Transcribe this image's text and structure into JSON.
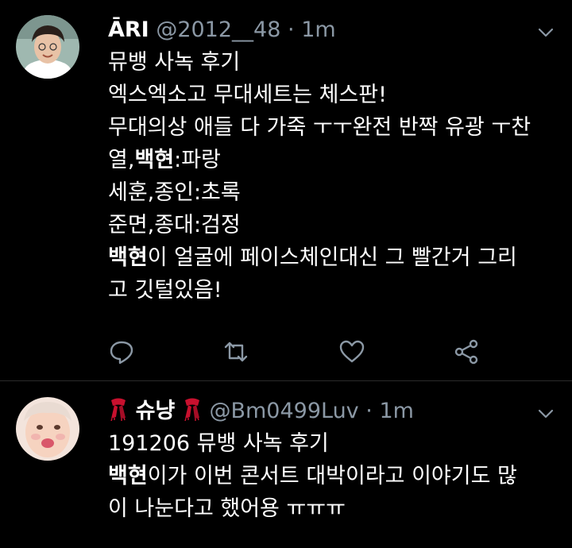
{
  "tweets": [
    {
      "name": "ĀRI",
      "handle": "@2012__48",
      "separator": "·",
      "time": "1m",
      "avatar_icon": "profile-photo",
      "lines": [
        [
          {
            "text": "뮤뱅 사녹 후기",
            "bold": false
          }
        ],
        [
          {
            "text": "엑스엑소고 무대세트는 체스판!",
            "bold": false
          }
        ],
        [
          {
            "text": "무대의상 애들 다 가죽 ㅜㅜ완전 반짝 유광 ㅜ찬",
            "bold": false
          }
        ],
        [
          {
            "text": "열,",
            "bold": false
          },
          {
            "text": "백현",
            "bold": true
          },
          {
            "text": ":파랑",
            "bold": false
          }
        ],
        [
          {
            "text": "세훈,종인:초록",
            "bold": false
          }
        ],
        [
          {
            "text": "준면,종대:검정",
            "bold": false
          }
        ],
        [
          {
            "text": "백현",
            "bold": true
          },
          {
            "text": "이 얼굴에 페이스체인대신 그 빨간거 그리",
            "bold": false
          }
        ],
        [
          {
            "text": "고 깃털있음!",
            "bold": false
          }
        ]
      ],
      "actions": [
        "reply-icon",
        "retweet-icon",
        "like-icon",
        "share-icon"
      ]
    },
    {
      "name": "슈냥",
      "name_decoration": "red-scarf-emoji",
      "handle": "@Bm0499Luv",
      "separator": "·",
      "time": "1m",
      "avatar_icon": "profile-photo",
      "lines": [
        [
          {
            "text": "191206 뮤뱅 사녹 후기",
            "bold": false
          }
        ],
        [
          {
            "text": "백현",
            "bold": true
          },
          {
            "text": "이가 이번 콘서트 대박이라고 이야기도 많",
            "bold": false
          }
        ],
        [
          {
            "text": "이 나눈다고 했어용 ㅠㅠㅠ",
            "bold": false
          }
        ]
      ]
    }
  ],
  "colors": {
    "background": "#000000",
    "text": "#ffffff",
    "secondary": "#8b98a5",
    "divider": "#2a2a2a",
    "scarf": "#c8102e"
  }
}
